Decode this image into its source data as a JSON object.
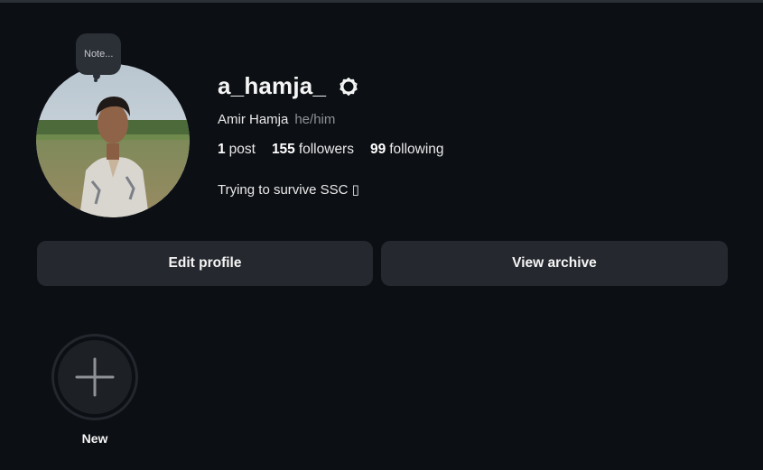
{
  "profile": {
    "note_label": "Note...",
    "username": "a_hamja_",
    "full_name": "Amir Hamja",
    "pronouns": "he/him",
    "bio": "Trying to survive SSC ▯"
  },
  "stats": {
    "posts_count": "1",
    "posts_label": "post",
    "followers_count": "155",
    "followers_label": "followers",
    "following_count": "99",
    "following_label": "following"
  },
  "actions": {
    "edit_profile_label": "Edit profile",
    "view_archive_label": "View archive"
  },
  "highlights": {
    "new_label": "New"
  },
  "icons": {
    "settings": "gear-icon",
    "new_highlight": "plus-icon"
  },
  "colors": {
    "background": "#0c0f14",
    "button_bg": "#25282e",
    "text_primary": "#f5f5f5",
    "text_secondary": "#8e9196"
  }
}
